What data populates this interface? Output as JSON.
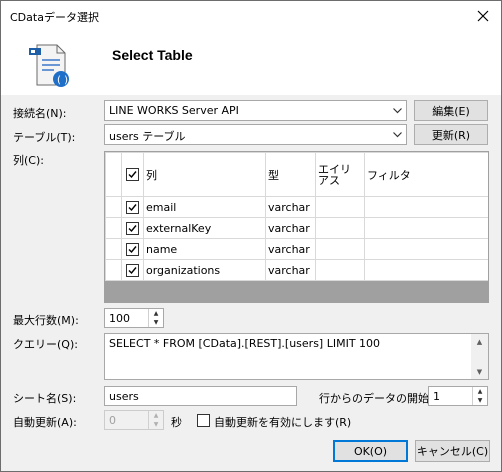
{
  "window": {
    "title": "CDataデータ選択"
  },
  "header": {
    "title": "Select Table"
  },
  "connection": {
    "label": "接続名(N):",
    "value": "LINE WORKS Server API",
    "edit_label": "編集(E)"
  },
  "table": {
    "label": "テーブル(T):",
    "value": "users テーブル",
    "refresh_label": "更新(R)"
  },
  "columns": {
    "label": "列(C):",
    "headers": {
      "column": "列",
      "type": "型",
      "alias": "エイリアス",
      "filter": "フィルタ"
    },
    "rows": [
      {
        "name": "email",
        "type": "varchar",
        "alias": "",
        "filter": ""
      },
      {
        "name": "externalKey",
        "type": "varchar",
        "alias": "",
        "filter": ""
      },
      {
        "name": "name",
        "type": "varchar",
        "alias": "",
        "filter": ""
      },
      {
        "name": "organizations",
        "type": "varchar",
        "alias": "",
        "filter": ""
      }
    ]
  },
  "max_rows": {
    "label": "最大行数(M):",
    "value": "100"
  },
  "query": {
    "label": "クエリー(Q):",
    "value": "SELECT * FROM [CData].[REST].[users] LIMIT 100"
  },
  "sheet": {
    "label": "シート名(S):",
    "value": "users",
    "start_row_label": "行からのデータの開始",
    "start_row_value": "1"
  },
  "auto_refresh": {
    "label": "自動更新(A):",
    "value": "0",
    "unit": "秒",
    "enable_label": "自動更新を有効にします(R)"
  },
  "footer": {
    "ok_label": "OK(O)",
    "cancel_label": "キャンセル(C)"
  }
}
